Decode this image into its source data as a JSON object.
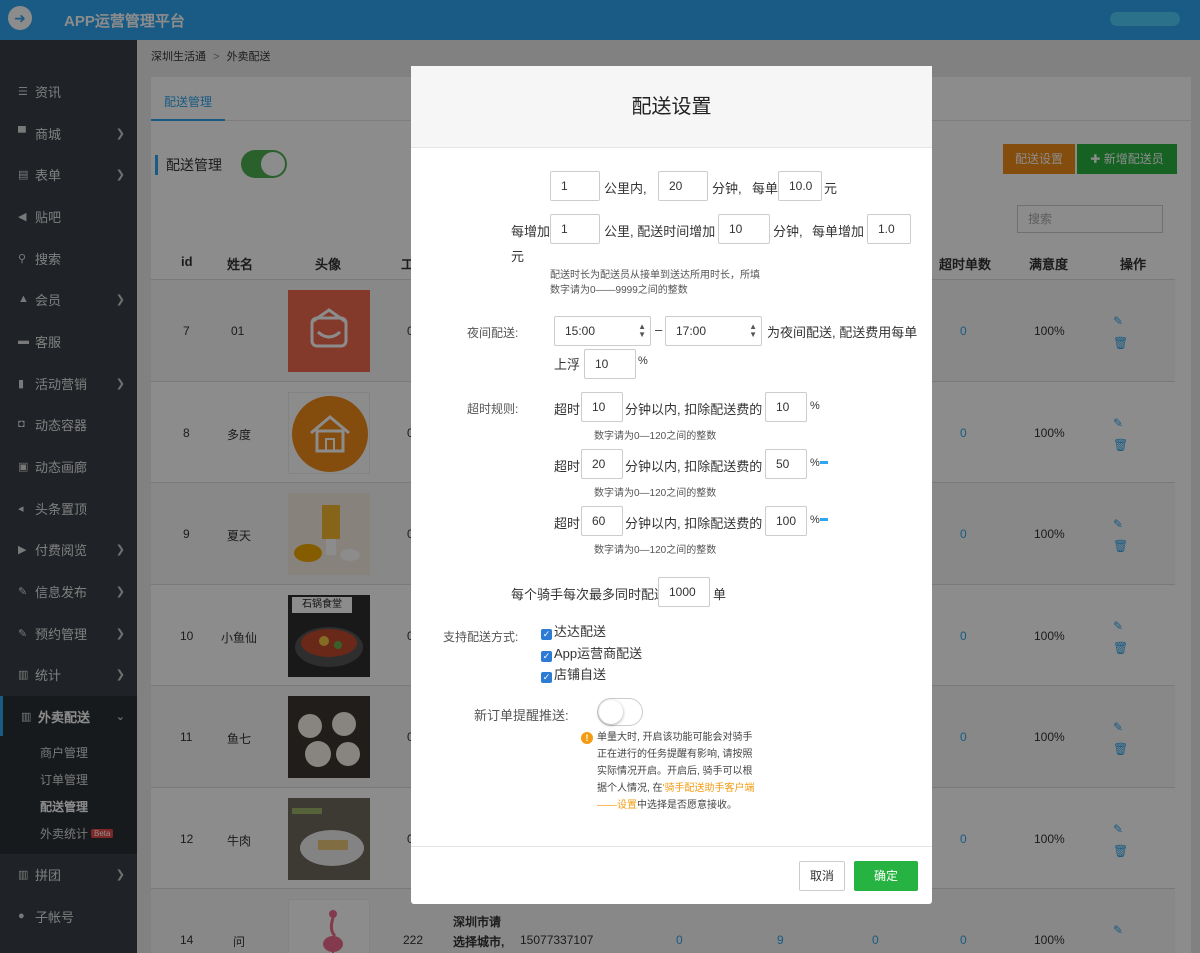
{
  "app": {
    "title": "APP运营管理平台"
  },
  "sidebar": {
    "items": [
      {
        "label": "资讯",
        "icon": "list-icon"
      },
      {
        "label": "商城",
        "icon": "cart-icon"
      },
      {
        "label": "表单",
        "icon": "form-icon"
      },
      {
        "label": "贴吧",
        "icon": "megaphone-icon"
      },
      {
        "label": "搜索",
        "icon": "search-icon"
      },
      {
        "label": "会员",
        "icon": "bell-icon"
      },
      {
        "label": "客服",
        "icon": "chat-icon"
      },
      {
        "label": "活动营销",
        "icon": "bookmark-icon"
      },
      {
        "label": "动态容器",
        "icon": "container-icon"
      },
      {
        "label": "动态画廊",
        "icon": "image-icon"
      },
      {
        "label": "头条置顶",
        "icon": "volume-icon"
      },
      {
        "label": "付费阅览",
        "icon": "play-icon"
      },
      {
        "label": "信息发布",
        "icon": "edit-icon"
      },
      {
        "label": "预约管理",
        "icon": "edit-icon"
      },
      {
        "label": "统计",
        "icon": "bar-chart-icon"
      },
      {
        "label": "外卖配送",
        "icon": "bar-chart-icon"
      }
    ],
    "sub_items": [
      "商户管理",
      "订单管理",
      "配送管理",
      "外卖统计"
    ],
    "beta": "Beta",
    "bottom_items": [
      {
        "label": "拼团",
        "icon": "bar-chart-icon"
      },
      {
        "label": "子帐号",
        "icon": "user-icon"
      }
    ]
  },
  "breadcrumb": {
    "root": "深圳生活通",
    "sep": ">",
    "current": "外卖配送"
  },
  "tab": "配送管理",
  "section": {
    "title": "配送管理",
    "enabled": true
  },
  "buttons": {
    "settings": "配送设置",
    "add": "新增配送员"
  },
  "search": {
    "placeholder": "搜索"
  },
  "table": {
    "headers": {
      "id": "id",
      "name": "姓名",
      "avatar": "头像",
      "gong": "工",
      "overtime": "超时单数",
      "satisfaction": "满意度",
      "ops": "操作"
    },
    "rows": [
      {
        "id": "7",
        "name": "01",
        "col": "0",
        "overtime": "0",
        "satisfaction": "100%"
      },
      {
        "id": "8",
        "name": "多度",
        "col": "0",
        "overtime": "0",
        "satisfaction": "100%"
      },
      {
        "id": "9",
        "name": "夏天",
        "col": "0",
        "overtime": "0",
        "satisfaction": "100%"
      },
      {
        "id": "10",
        "name": "小鱼仙",
        "col": "0",
        "overtime": "0",
        "satisfaction": "100%"
      },
      {
        "id": "11",
        "name": "鱼七",
        "col": "0",
        "overtime": "0",
        "satisfaction": "100%"
      },
      {
        "id": "12",
        "name": "牛肉",
        "col": "0",
        "overtime": "0",
        "satisfaction": "100%"
      },
      {
        "id": "14",
        "name": "问",
        "col": "222",
        "addr1": "深圳市请",
        "addr2": "选择城市,",
        "phone": "15077337107",
        "c1": "0",
        "c2": "9",
        "c3": "0",
        "overtime": "0",
        "satisfaction": "100%"
      }
    ],
    "restaurant_sign": "石锅食堂"
  },
  "modal": {
    "title": "配送设置",
    "base": {
      "km": "1",
      "km_unit": "公里内,",
      "min": "20",
      "min_unit": "分钟,",
      "per_order": "每单",
      "price": "10.0",
      "yuan": "元"
    },
    "increment": {
      "prefix": "每增加",
      "km": "1",
      "mid": "公里, 配送时间增加",
      "min": "10",
      "min_unit": "分钟,",
      "per": "每单增加",
      "price": "1.0",
      "yuan": "元"
    },
    "hint1a": "配送时长为配送员从接单到送达所用时长，所填",
    "hint1b": "数字请为0——9999之间的整数",
    "night": {
      "label": "夜间配送:",
      "start": "15:00",
      "dash": "–",
      "end": "17:00",
      "text1": "为夜间配送, 配送费用每单",
      "text2": "上浮",
      "pct": "10",
      "unit": "%"
    },
    "overtime": {
      "label": "超时规则:",
      "rules": [
        {
          "pre": "超时",
          "min": "10",
          "mid": "分钟以内, 扣除配送费的",
          "pct": "10",
          "unit": "%",
          "hint": "数字请为0—120之间的整数"
        },
        {
          "pre": "超时",
          "min": "20",
          "mid": "分钟以内, 扣除配送费的",
          "pct": "50",
          "unit": "%",
          "hint": "数字请为0—120之间的整数"
        },
        {
          "pre": "超时",
          "min": "60",
          "mid": "分钟以内, 扣除配送费的",
          "pct": "100",
          "unit": "%",
          "hint": "数字请为0—120之间的整数"
        }
      ]
    },
    "max": {
      "pre": "每个骑手每次最多同时配送",
      "value": "1000",
      "unit": "单"
    },
    "methods": {
      "label": "支持配送方式:",
      "options": [
        "达达配送",
        "App运营商配送",
        "店铺自送"
      ]
    },
    "push": {
      "label": "新订单提醒推送:",
      "enabled": false
    },
    "warn": {
      "l1": "单量大时, 开启该功能可能会对骑手",
      "l2": "正在进行的任务提醒有影响, 请按照",
      "l3": "实际情况开启。开启后, 骑手可以根",
      "l4a": "据个人情况, 在",
      "l4b": "'骑手配送助手客户端",
      "l5a": "——设置",
      "l5b": "中选择是否愿意接收。"
    },
    "cancel": "取消",
    "confirm": "确定"
  }
}
